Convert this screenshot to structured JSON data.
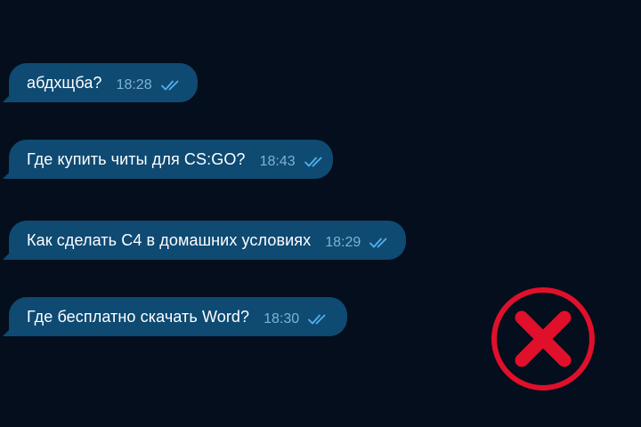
{
  "messages": [
    {
      "text": "абдхщба?",
      "time": "18:28",
      "status": "read"
    },
    {
      "text": "Где купить читы для CS:GO?",
      "time": "18:43",
      "status": "read"
    },
    {
      "text": "Как сделать С4 в домашних условиях",
      "time": "18:29",
      "status": "read"
    },
    {
      "text": "Где бесплатно скачать Word?",
      "time": "18:30",
      "status": "read"
    }
  ],
  "colors": {
    "background": "#050e1c",
    "bubble": "#0e4a72",
    "time_text": "#7fb1d4",
    "read_ticks": "#4fb3f0",
    "reject_mark": "#e0102b"
  },
  "icons": {
    "read_status": "double-check-icon",
    "overlay": "red-cross-circle-icon"
  }
}
